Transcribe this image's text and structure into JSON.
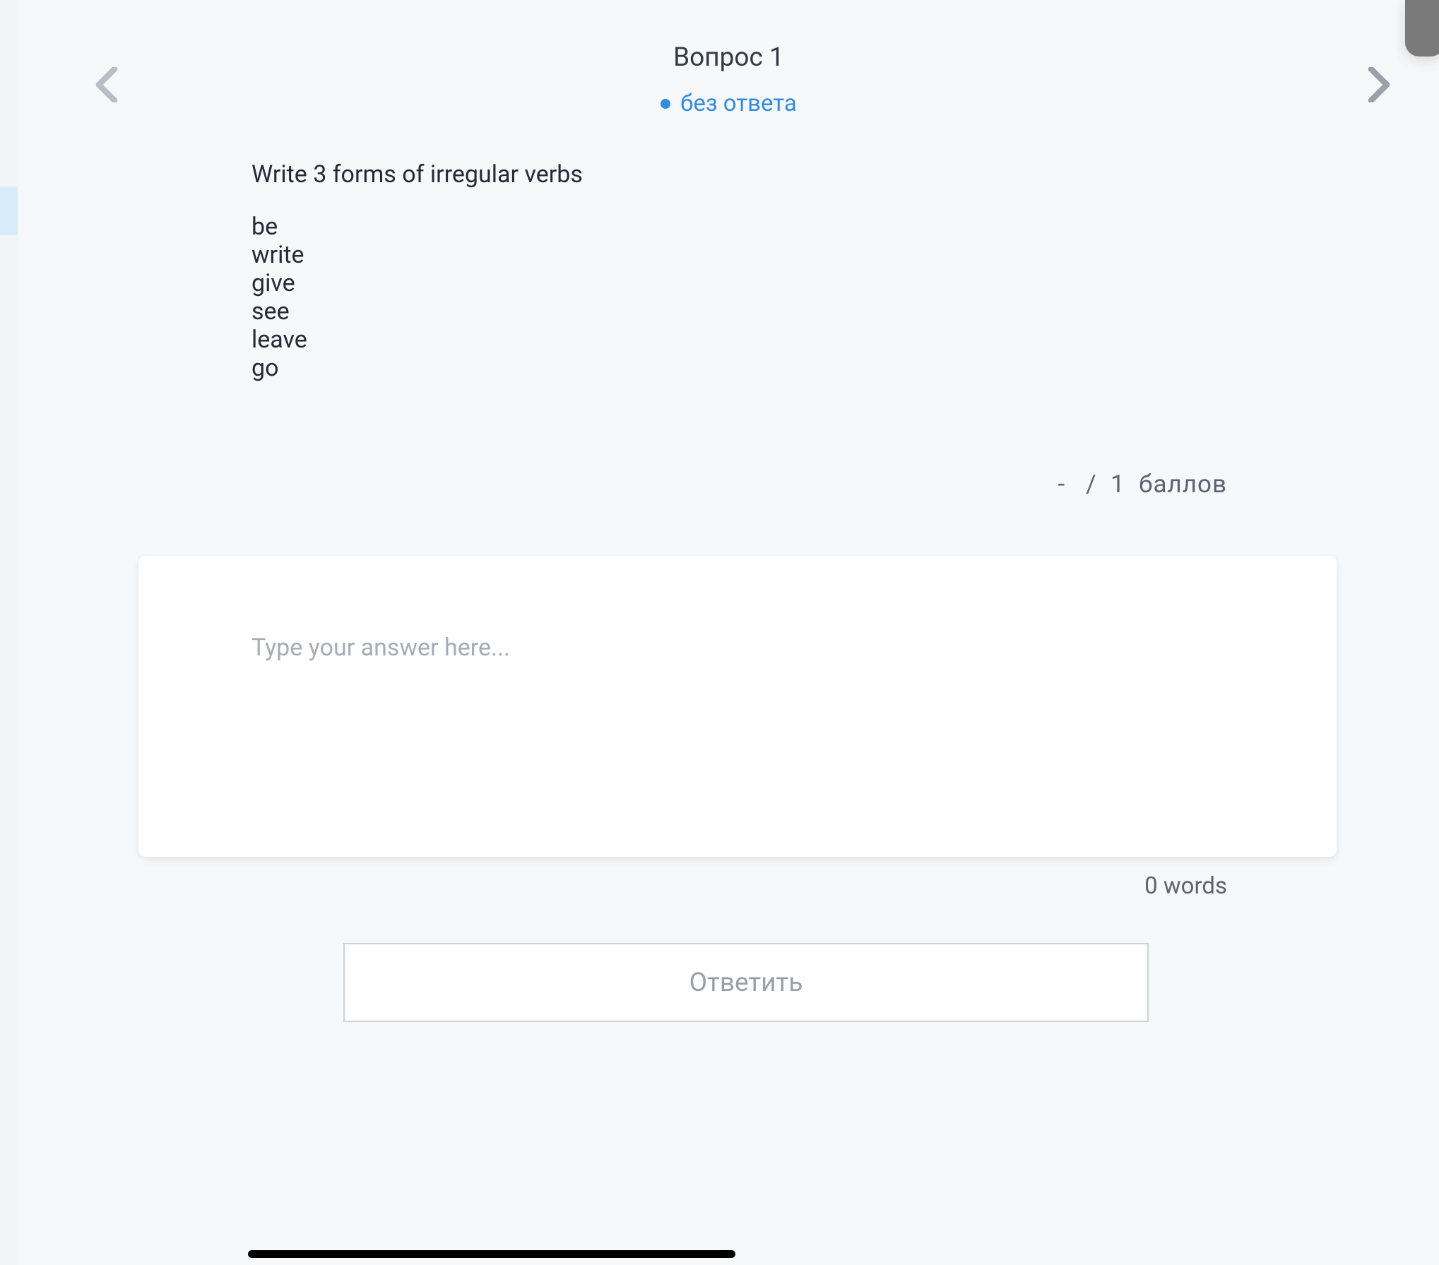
{
  "header": {
    "question_title": "Вопрос 1",
    "status_text": "без ответа"
  },
  "question": {
    "prompt": "Write 3 forms of irregular verbs",
    "verbs": [
      "be",
      "write",
      "give",
      "see",
      "leave",
      "go"
    ]
  },
  "points": {
    "earned": "-",
    "separator": "/",
    "total": "1",
    "label": "баллов"
  },
  "answer": {
    "placeholder": "Type your answer here...",
    "value": "",
    "word_count_value": "0",
    "word_count_label": "words"
  },
  "submit": {
    "label": "Ответить"
  }
}
